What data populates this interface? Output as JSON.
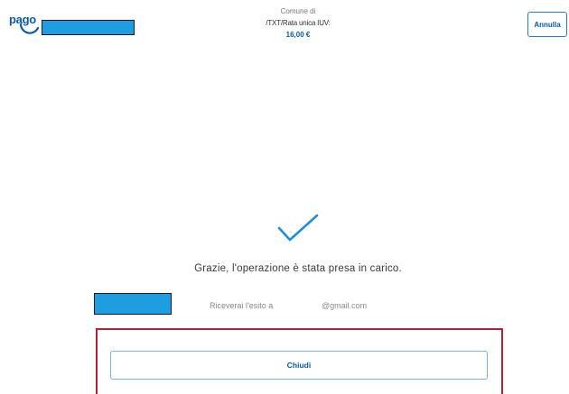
{
  "header": {
    "logo_text": "pago",
    "comune_label": "Comune di",
    "payment_description": "/TXT/Rata unica IUV:",
    "amount": "16,00 €",
    "cancel_label": "Annulla"
  },
  "main": {
    "confirmation_message": "Grazie, l'operazione è stata presa in carico.",
    "receipt_label": "Riceverai l'esito a",
    "receipt_email_suffix": "@gmail.com",
    "close_label": "Chiudi"
  },
  "colors": {
    "brand": "#0b5aa8",
    "success_check": "#1e8fd6",
    "redaction": "#1e9de0",
    "highlight_frame": "#b8203a"
  },
  "icons": {
    "confirmation": "checkmark-icon",
    "logo": "pagopa-logo-arc"
  }
}
